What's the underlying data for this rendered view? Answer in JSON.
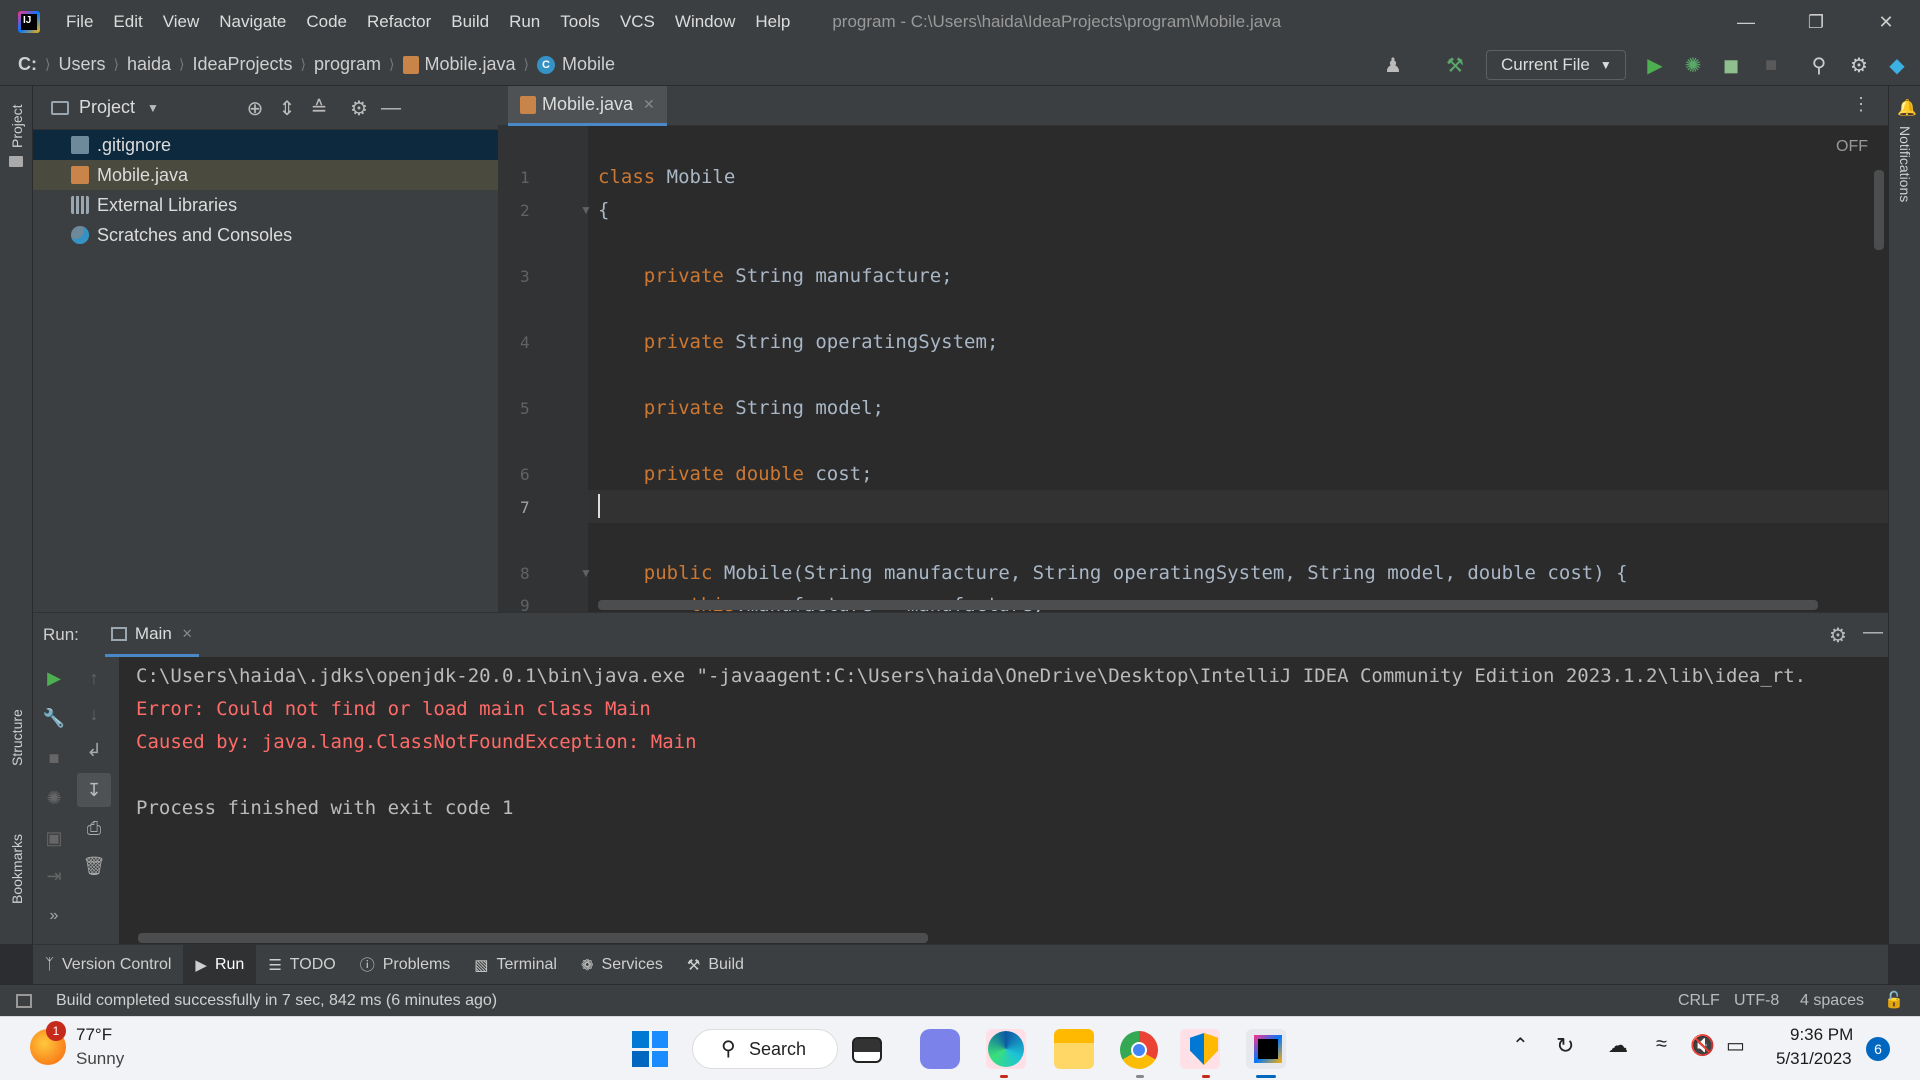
{
  "window": {
    "title": "program - C:\\Users\\haida\\IdeaProjects\\program\\Mobile.java",
    "menu": [
      "File",
      "Edit",
      "View",
      "Navigate",
      "Code",
      "Refactor",
      "Build",
      "Run",
      "Tools",
      "VCS",
      "Window",
      "Help"
    ]
  },
  "breadcrumbs": [
    "C:",
    "Users",
    "haida",
    "IdeaProjects",
    "program",
    "Mobile.java",
    "Mobile"
  ],
  "toolbar": {
    "run_config": "Current File"
  },
  "left_stripe": {
    "project": "Project",
    "structure": "Structure",
    "bookmarks": "Bookmarks"
  },
  "right_stripe": {
    "notifications": "Notifications"
  },
  "project_panel": {
    "title": "Project",
    "items": [
      {
        "label": ".gitignore",
        "icon": "gitignore-file-icon"
      },
      {
        "label": "Mobile.java",
        "icon": "java-file-icon"
      },
      {
        "label": "External Libraries",
        "icon": "libraries-icon"
      },
      {
        "label": "Scratches and Consoles",
        "icon": "scratches-icon"
      }
    ]
  },
  "editor": {
    "tab": "Mobile.java",
    "inspection": "OFF",
    "lines": [
      {
        "n": "1",
        "kw": "class",
        "rest": " Mobile"
      },
      {
        "n": "2",
        "kw": "",
        "rest": "{"
      },
      {
        "n": "3",
        "kw": "    private",
        "rest": " String manufacture;"
      },
      {
        "n": "4",
        "kw": "    private",
        "rest": " String operatingSystem;"
      },
      {
        "n": "5",
        "kw": "    private",
        "rest": " String model;"
      },
      {
        "n": "6",
        "kw": "    private double",
        "rest": " cost;"
      },
      {
        "n": "7",
        "kw": "",
        "rest": ""
      },
      {
        "n": "8",
        "kw": "    public",
        "rest": " Mobile(String manufacture, String operatingSystem, String model, double cost) {"
      },
      {
        "n": "9",
        "kw": "        this",
        "rest": ".manufacture = manufacture;"
      }
    ]
  },
  "run_panel": {
    "label": "Run:",
    "tab": "Main",
    "output": [
      {
        "text": "C:\\Users\\haida\\.jdks\\openjdk-20.0.1\\bin\\java.exe \"-javaagent:C:\\Users\\haida\\OneDrive\\Desktop\\IntelliJ IDEA Community Edition 2023.1.2\\lib\\idea_rt.",
        "color": "#cfcfcf"
      },
      {
        "text": "Error: Could not find or load main class Main",
        "color": "#ff6b68"
      },
      {
        "text": "Caused by: java.lang.ClassNotFoundException: Main",
        "color": "#ff6b68"
      },
      {
        "text": "",
        "color": "#cfcfcf"
      },
      {
        "text": "Process finished with exit code 1",
        "color": "#cfcfcf"
      }
    ]
  },
  "tool_tabs": [
    "Version Control",
    "Run",
    "TODO",
    "Problems",
    "Terminal",
    "Services",
    "Build"
  ],
  "status_bar": {
    "message": "Build completed successfully in 7 sec, 842 ms (6 minutes ago)",
    "line_sep": "CRLF",
    "encoding": "UTF-8",
    "indent": "4 spaces"
  },
  "taskbar": {
    "weather_temp": "77°F",
    "weather_desc": "Sunny",
    "weather_badge": "1",
    "search": "Search",
    "time": "9:36 PM",
    "date": "5/31/2023",
    "notif_count": "6"
  },
  "colors": {
    "accent": "#4a88c7",
    "error": "#ff6b68",
    "keyword": "#cc7832",
    "run_green": "#4caf50"
  }
}
